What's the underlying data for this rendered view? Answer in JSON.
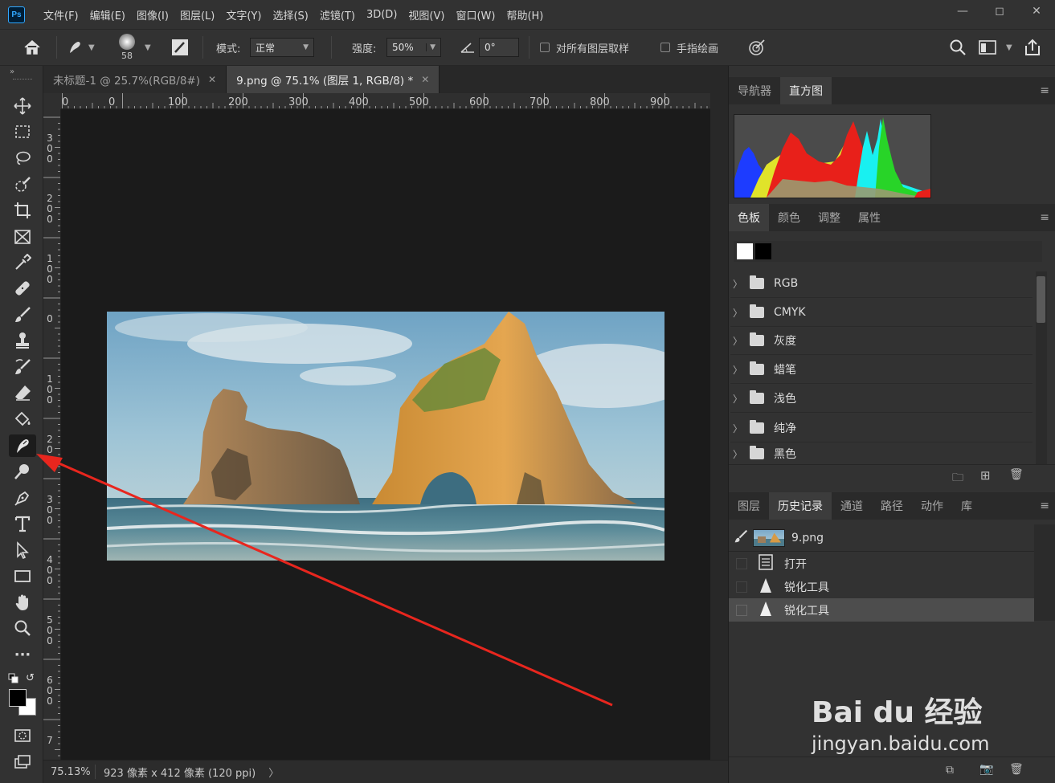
{
  "app": {
    "logo": "Ps",
    "menu": [
      "文件(F)",
      "编辑(E)",
      "图像(I)",
      "图层(L)",
      "文字(Y)",
      "选择(S)",
      "滤镜(T)",
      "3D(D)",
      "视图(V)",
      "窗口(W)",
      "帮助(H)"
    ],
    "window_controls": [
      "minimize-icon",
      "maximize-icon",
      "close-icon"
    ]
  },
  "options": {
    "brush_size": "58",
    "mode_label": "模式:",
    "mode_value": "正常",
    "strength_label": "强度:",
    "strength_value": "50%",
    "angle_value": "0°",
    "sample_all_layers": "对所有图层取样",
    "finger_painting": "手指绘画"
  },
  "documents": {
    "tabs": [
      {
        "label": "未标题-1 @ 25.7%(RGB/8#)",
        "active": false
      },
      {
        "label": "9.png @ 75.1% (图层 1, RGB/8) *",
        "active": true
      }
    ]
  },
  "rulers": {
    "horizontal": [
      "0",
      "0",
      "100",
      "200",
      "300",
      "400",
      "500",
      "600",
      "700",
      "800",
      "900"
    ],
    "vertical": [
      "300",
      "200",
      "100",
      "0",
      "100",
      "200",
      "300",
      "400",
      "500",
      "600",
      "7"
    ]
  },
  "status": {
    "zoom": "75.13%",
    "doc_info": "923 像素 x 412 像素 (120 ppi)"
  },
  "panels": {
    "top_tabs": [
      "导航器",
      "直方图"
    ],
    "top_active": "直方图",
    "mid_tabs": [
      "色板",
      "颜色",
      "调整",
      "属性"
    ],
    "mid_active": "色板",
    "swatch_groups": [
      "RGB",
      "CMYK",
      "灰度",
      "蜡笔",
      "浅色",
      "纯净",
      "黑色"
    ],
    "bottom_tabs": [
      "图层",
      "历史记录",
      "通道",
      "路径",
      "动作",
      "库"
    ],
    "bottom_active": "历史记录",
    "history_source": "9.png",
    "history_steps": [
      {
        "label": "打开",
        "icon": "document-icon"
      },
      {
        "label": "锐化工具",
        "icon": "sharpen-icon"
      },
      {
        "label": "锐化工具",
        "icon": "sharpen-icon"
      }
    ]
  },
  "watermark": {
    "brand": "Bai du 经验",
    "url": "jingyan.baidu.com"
  },
  "colors": {
    "annotation_arrow": "#e8261e",
    "accent": "#31a8ff"
  }
}
